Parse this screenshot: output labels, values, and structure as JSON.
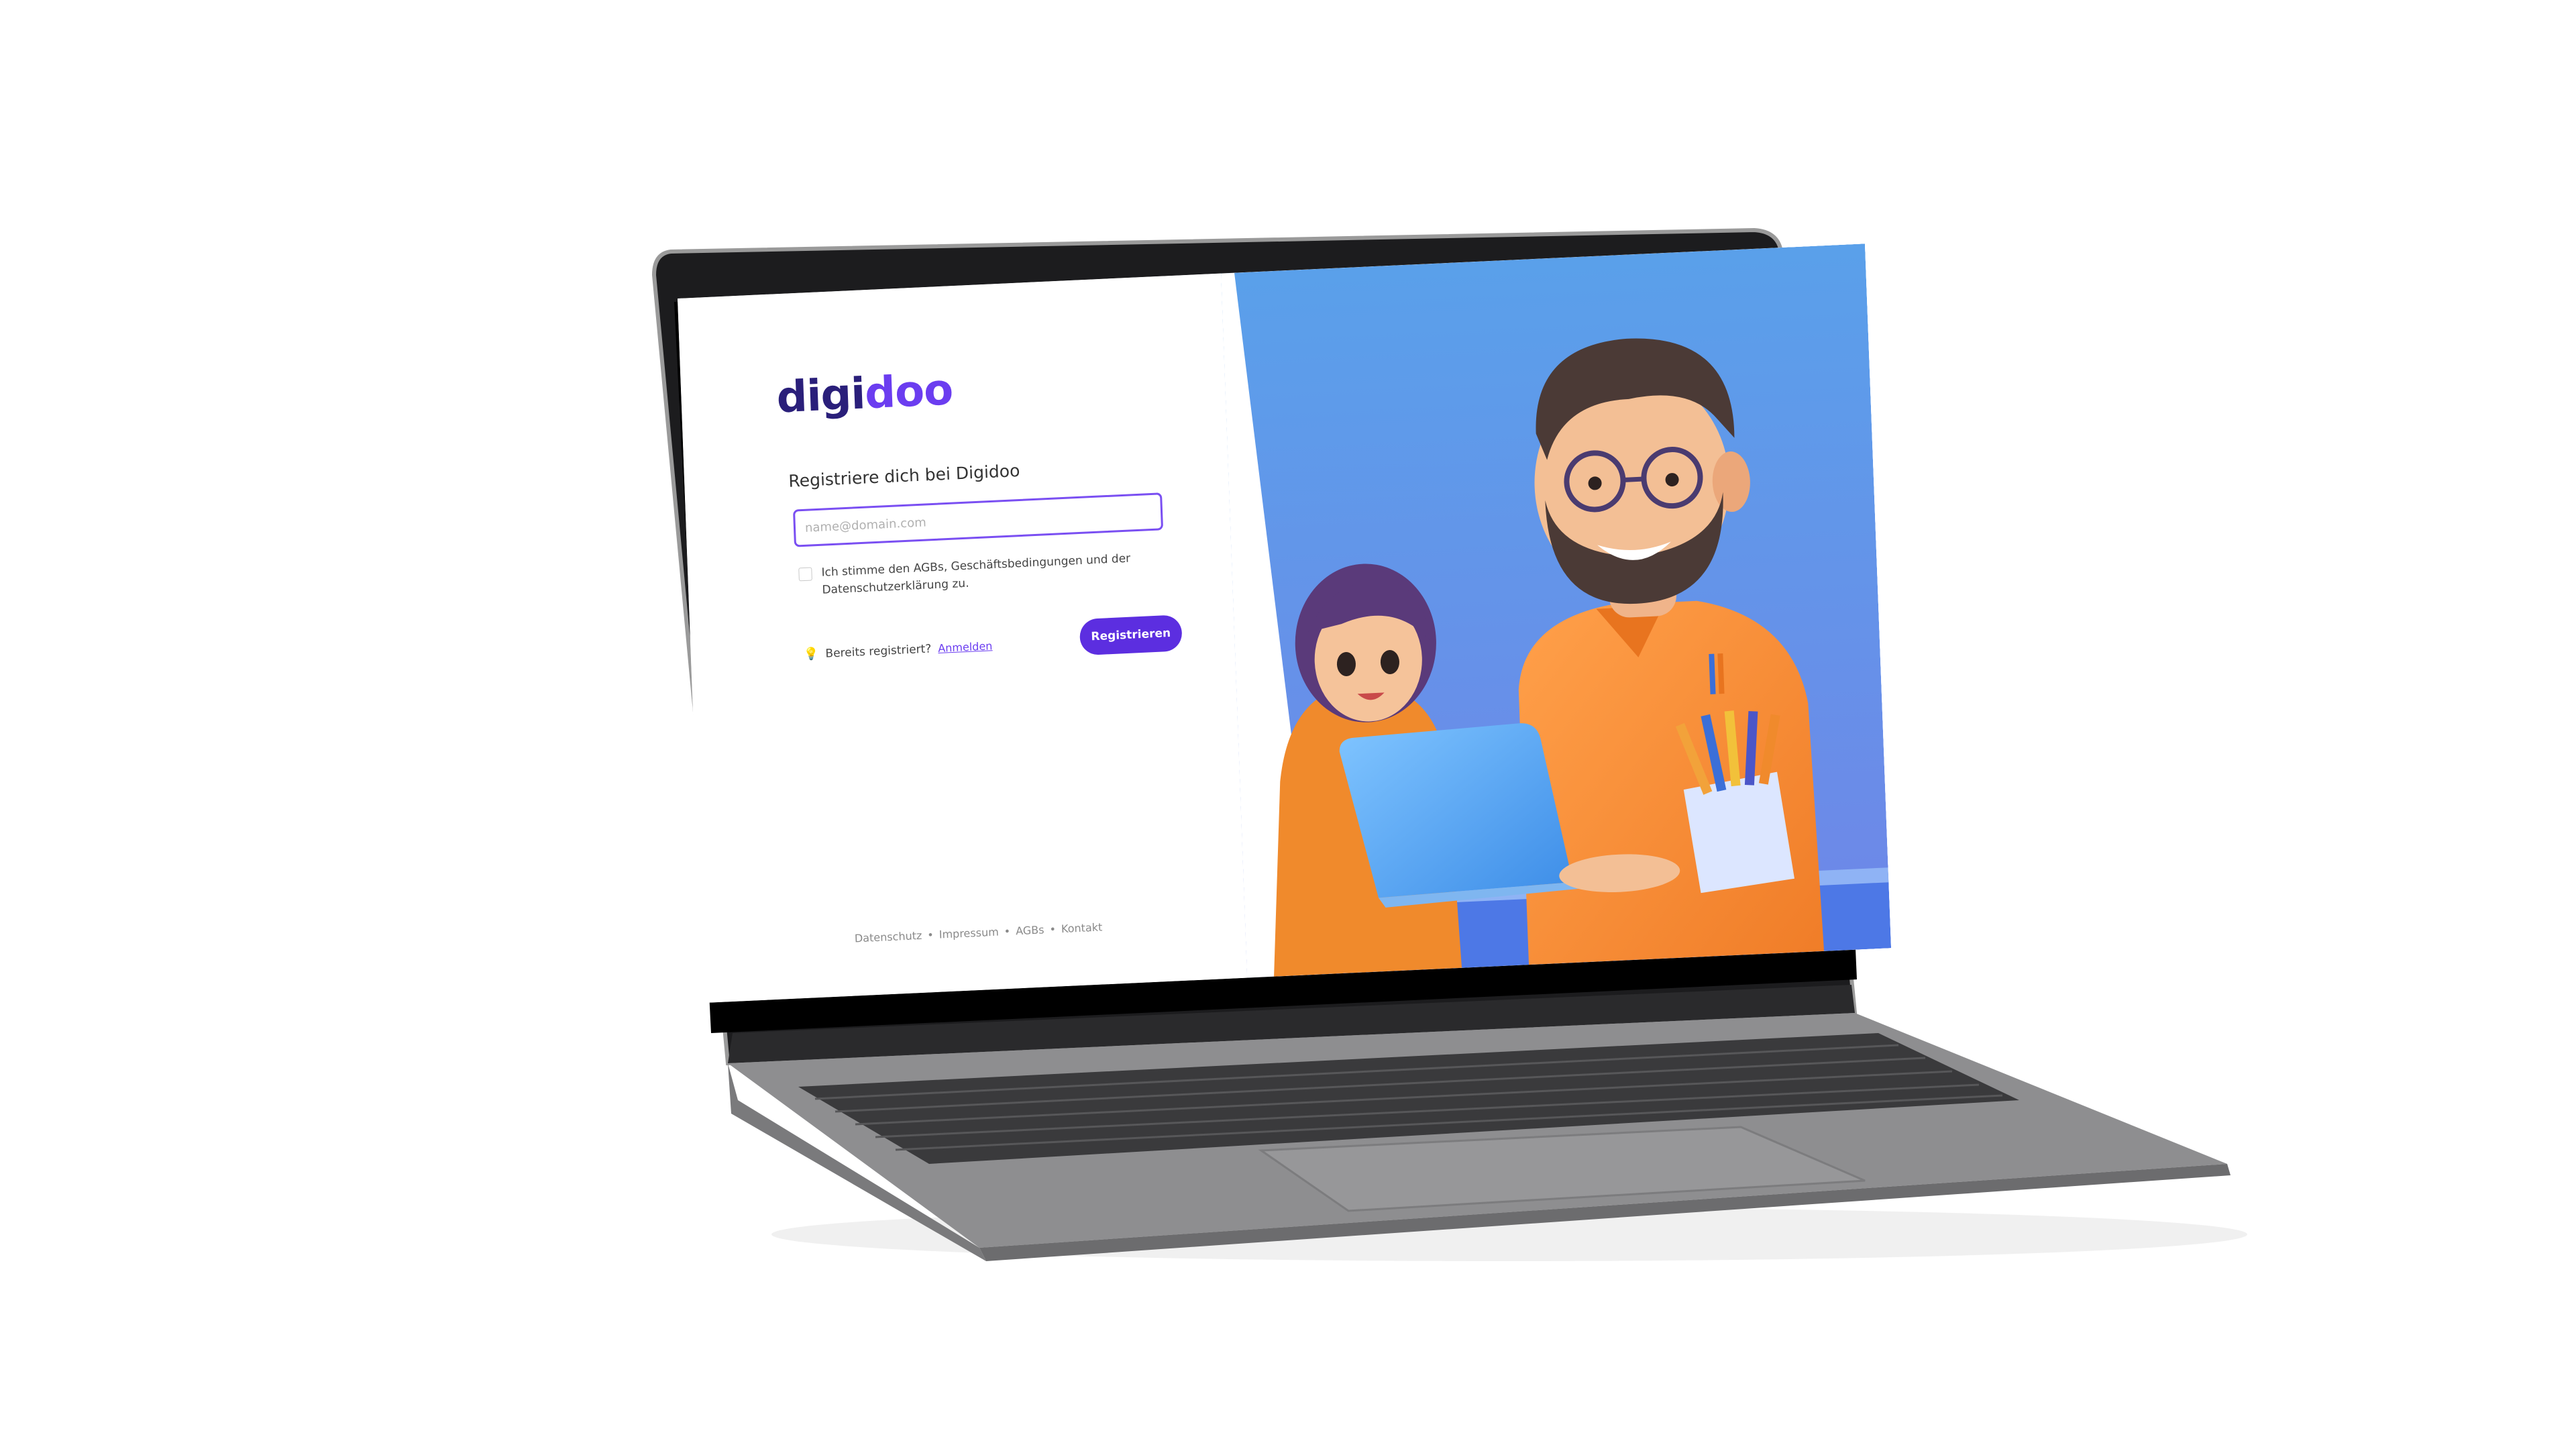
{
  "app": {
    "logo_part1": "digi",
    "logo_part2": "doo",
    "brand_dark": "#2a1f7a",
    "brand_accent": "#6b3df0"
  },
  "register": {
    "title": "Registriere dich bei Digidoo",
    "email_placeholder": "name@domain.com",
    "email_value": "",
    "agree_label": "Ich stimme den AGBs, Geschäftsbedingungen und der Datenschutzerklärung zu.",
    "agree_checked": false,
    "already_text": "Bereits registriert?",
    "login_link": "Anmelden",
    "submit_label": "Registrieren",
    "bulb_icon": "lightbulb-icon"
  },
  "footer": {
    "links": [
      "Datenschutz",
      "Impressum",
      "AGBs",
      "Kontakt"
    ],
    "separator": "•"
  },
  "illustration": {
    "description_icon": "illustration-father-daughter-laptop"
  }
}
